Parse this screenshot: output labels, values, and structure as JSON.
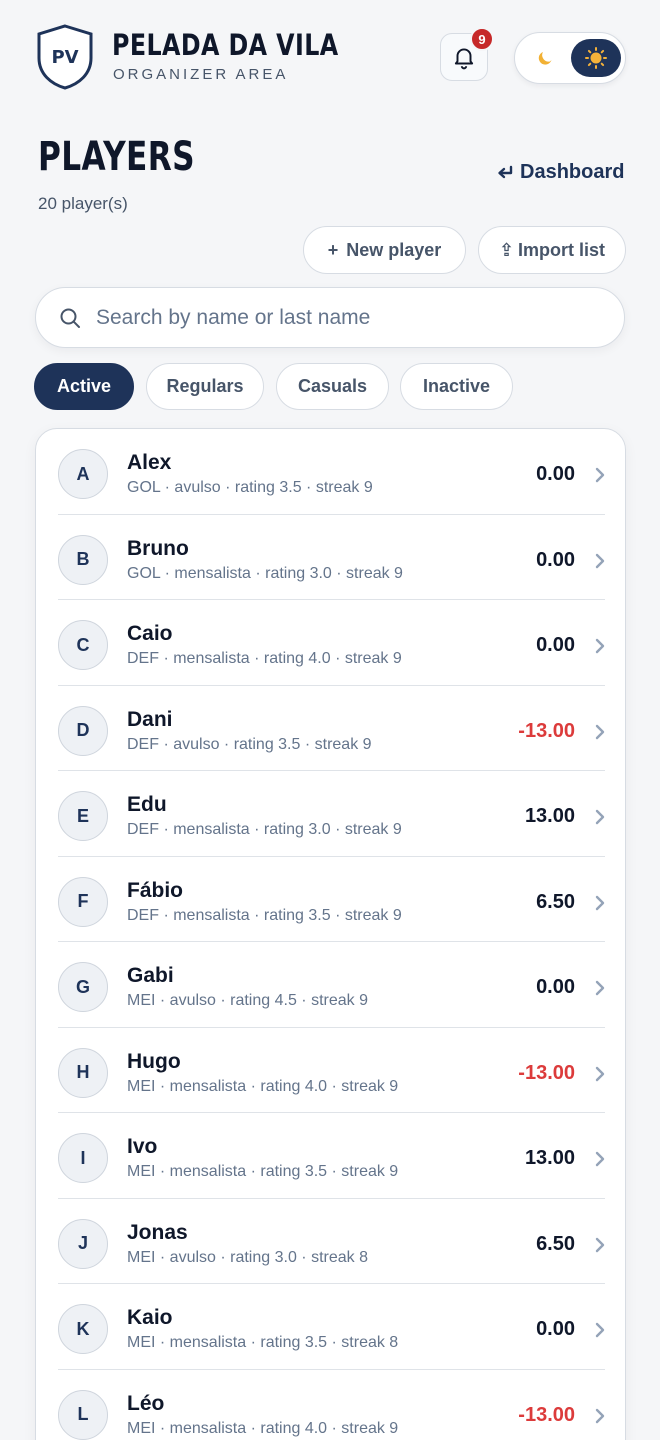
{
  "header": {
    "logo_monogram": "PV",
    "title": "PELADA DA VILA",
    "subtitle": "ORGANIZER AREA",
    "notifications_count": "9",
    "bell_icon": "bell-icon",
    "theme_toggle": {
      "left_icon": "moon-icon",
      "right_icon": "sun-icon",
      "selected": "light"
    }
  },
  "page": {
    "title": "PLAYERS",
    "player_count": "20 player(s)",
    "dashboard_link": "Dashboard",
    "dashboard_icon": "return-arrow-icon"
  },
  "actions": {
    "new_player": {
      "icon": "+",
      "label": "New player"
    },
    "import_list": {
      "icon": "⇪",
      "label": "Import list"
    }
  },
  "search": {
    "placeholder": "Search by name or last name",
    "value": ""
  },
  "filters": [
    {
      "label": "Active",
      "active": true
    },
    {
      "label": "Regulars",
      "active": false
    },
    {
      "label": "Casuals",
      "active": false
    },
    {
      "label": "Inactive",
      "active": false
    }
  ],
  "colors": {
    "primary": "#1e3359",
    "negative": "#dc3b3b",
    "badge": "#c62828",
    "background": "#f5f6f8"
  },
  "players": [
    {
      "initial": "A",
      "name": "Alex",
      "meta": "GOL · avulso · rating 3.5 · streak 9",
      "balance": "0.00",
      "negative": false
    },
    {
      "initial": "B",
      "name": "Bruno",
      "meta": "GOL · mensalista · rating 3.0 · streak 9",
      "balance": "0.00",
      "negative": false
    },
    {
      "initial": "C",
      "name": "Caio",
      "meta": "DEF · mensalista · rating 4.0 · streak 9",
      "balance": "0.00",
      "negative": false
    },
    {
      "initial": "D",
      "name": "Dani",
      "meta": "DEF · avulso · rating 3.5 · streak 9",
      "balance": "-13.00",
      "negative": true
    },
    {
      "initial": "E",
      "name": "Edu",
      "meta": "DEF · mensalista · rating 3.0 · streak 9",
      "balance": "13.00",
      "negative": false
    },
    {
      "initial": "F",
      "name": "Fábio",
      "meta": "DEF · mensalista · rating 3.5 · streak 9",
      "balance": "6.50",
      "negative": false
    },
    {
      "initial": "G",
      "name": "Gabi",
      "meta": "MEI · avulso · rating 4.5 · streak 9",
      "balance": "0.00",
      "negative": false
    },
    {
      "initial": "H",
      "name": "Hugo",
      "meta": "MEI · mensalista · rating 4.0 · streak 9",
      "balance": "-13.00",
      "negative": true
    },
    {
      "initial": "I",
      "name": "Ivo",
      "meta": "MEI · mensalista · rating 3.5 · streak 9",
      "balance": "13.00",
      "negative": false
    },
    {
      "initial": "J",
      "name": "Jonas",
      "meta": "MEI · avulso · rating 3.0 · streak 8",
      "balance": "6.50",
      "negative": false
    },
    {
      "initial": "K",
      "name": "Kaio",
      "meta": "MEI · mensalista · rating 3.5 · streak 8",
      "balance": "0.00",
      "negative": false
    },
    {
      "initial": "L",
      "name": "Léo",
      "meta": "MEI · mensalista · rating 4.0 · streak 9",
      "balance": "-13.00",
      "negative": true
    }
  ]
}
